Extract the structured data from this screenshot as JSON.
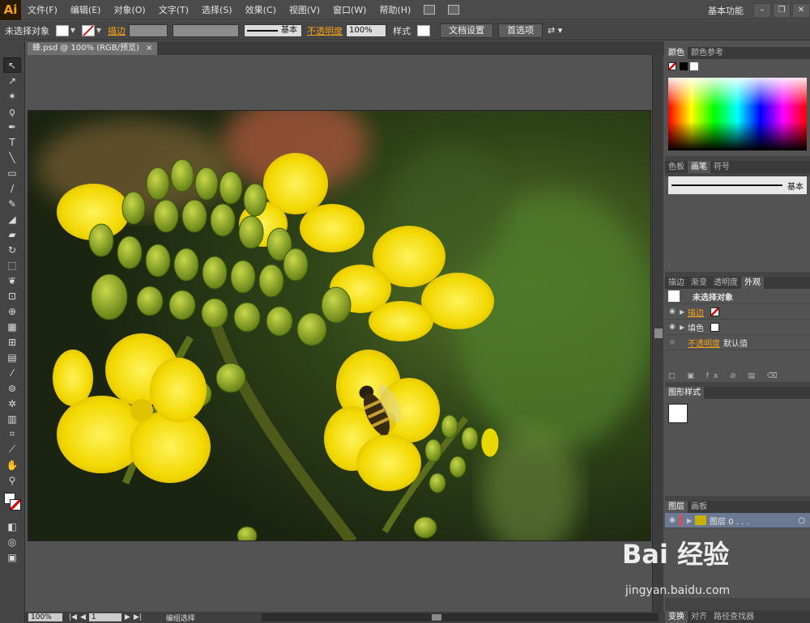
{
  "app": {
    "logo": "Ai",
    "workspace": "基本功能"
  },
  "menu": [
    "文件(F)",
    "编辑(E)",
    "对象(O)",
    "文字(T)",
    "选择(S)",
    "效果(C)",
    "视图(V)",
    "窗口(W)",
    "帮助(H)"
  ],
  "window_controls": {
    "minimize": "–",
    "restore": "❐",
    "close": "✕"
  },
  "control_bar": {
    "selection": "未选择对象",
    "stroke_label": "描边",
    "brush_label": "基本",
    "opacity_label": "不透明度",
    "opacity_value": "100%",
    "style_label": "样式",
    "doc_setup": "文档设置",
    "preferences": "首选项"
  },
  "document": {
    "tab_title": "蜂.psd @ 100% (RGB/预览)",
    "close": "×"
  },
  "status": {
    "zoom": "100%",
    "artboard": "1",
    "mode": "编组选择"
  },
  "panels": {
    "color": {
      "tabs": [
        "颜色",
        "颜色参考"
      ]
    },
    "brushes": {
      "tabs": [
        "色板",
        "画笔",
        "符号"
      ],
      "brush_name": "基本"
    },
    "appearance": {
      "tabs": [
        "描边",
        "渐变",
        "透明度",
        "外观"
      ],
      "title": "未选择对象",
      "stroke": "描边",
      "fill": "填色",
      "opacity": "不透明度",
      "opacity_value": "默认值"
    },
    "graphic_styles": {
      "tabs": [
        "图形样式"
      ]
    },
    "layers": {
      "tabs": [
        "图层",
        "画板"
      ],
      "layer_name": "图层 0 . . ."
    },
    "bottom_tabs": [
      "变换",
      "对齐",
      "路径查找器"
    ]
  },
  "watermark": {
    "brand": "Bai 经验",
    "url": "jingyan.baidu.com"
  },
  "colors": {
    "accent": "#f7a21b",
    "ui_bg": "#535353",
    "panel": "#444444"
  }
}
